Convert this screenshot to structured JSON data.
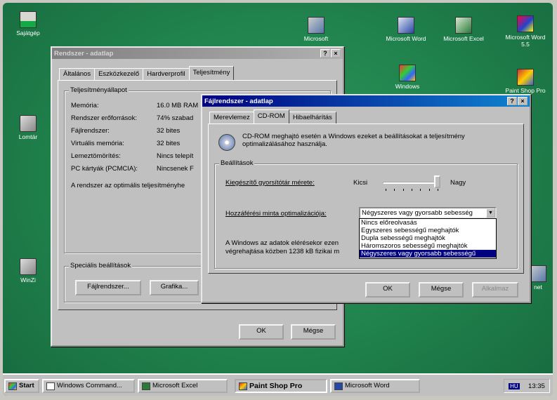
{
  "desktop": {
    "icons": [
      {
        "id": "sajatgep",
        "label": "Sajátgép"
      },
      {
        "id": "lomtar",
        "label": "Lomtár"
      },
      {
        "id": "microsoft",
        "label": "Microsoft"
      },
      {
        "id": "msword",
        "label": "Microsoft Word"
      },
      {
        "id": "msexcel",
        "label": "Microsoft Excel"
      },
      {
        "id": "msword55",
        "label": "Microsoft Word 5.5"
      },
      {
        "id": "windows",
        "label": "Windows"
      },
      {
        "id": "paintshop",
        "label": "Paint Shop Pro"
      },
      {
        "id": "win",
        "label": "WinZi"
      },
      {
        "id": "net",
        "label": "net"
      }
    ]
  },
  "system_window": {
    "title": "Rendszer - adatlap",
    "tabs": [
      "Általános",
      "Eszközkezelő",
      "Hardverprofil",
      "Teljesítmény"
    ],
    "group_title": "Teljesítményállapot",
    "rows": [
      {
        "label": "Memória:",
        "value": "16.0 MB RAM"
      },
      {
        "label": "Rendszer erőforrások:",
        "value": "74% szabad"
      },
      {
        "label": "Fájlrendszer:",
        "value": "32 bites"
      },
      {
        "label": "Virtuális memória:",
        "value": "32 bites"
      },
      {
        "label": "Lemeztömörítés:",
        "value": "Nincs telepít"
      },
      {
        "label": "PC kártyák (PCMCIA):",
        "value": "Nincsenek F"
      }
    ],
    "status_text": "A rendszer az optimális teljesítményhe",
    "advanced_group": "Speciális beállítások",
    "btn_filesystem": "Fájlrendszer...",
    "btn_graphics": "Grafika...",
    "btn_ok": "OK",
    "btn_cancel": "Mégse"
  },
  "fs_window": {
    "title": "Fájlrendszer - adatlap",
    "tabs": [
      "Merevlemez",
      "CD-ROM",
      "Hibaelhárítás"
    ],
    "intro": "CD-ROM meghajtó esetén a Windows ezeket a beállításokat a teljesítmény optimalizálásához használja.",
    "settings_group": "Beállítások",
    "cache_label": "Kiegészítő gyorsítótár mérete:",
    "cache_small": "Kicsi",
    "cache_large": "Nagy",
    "cache_level": 1.0,
    "access_label": "Hozzáférési minta optimalizációja:",
    "access_selected": "Négyszeres vagy gyorsabb sebesség",
    "access_options": [
      "Nincs előreolvasás",
      "Egyszeres sebességű meghajtók",
      "Dupla sebességű meghajtók",
      "Háromszoros sebességű meghajtók",
      "Négyszeres vagy gyorsabb sebességű"
    ],
    "access_highlight_index": 4,
    "info_text_1": "A Windows az adatok elérésekor ezen",
    "info_text_2": "végrehajtása közben 1238 kB fizikai m",
    "btn_ok": "OK",
    "btn_cancel": "Mégse",
    "btn_apply": "Alkalmaz"
  },
  "taskbar": {
    "start": "Start",
    "items": [
      "Windows Command...",
      "Microsoft Excel",
      "Paint Shop Pro",
      "Microsoft Word"
    ],
    "lang": "HU",
    "clock": "13:35"
  }
}
